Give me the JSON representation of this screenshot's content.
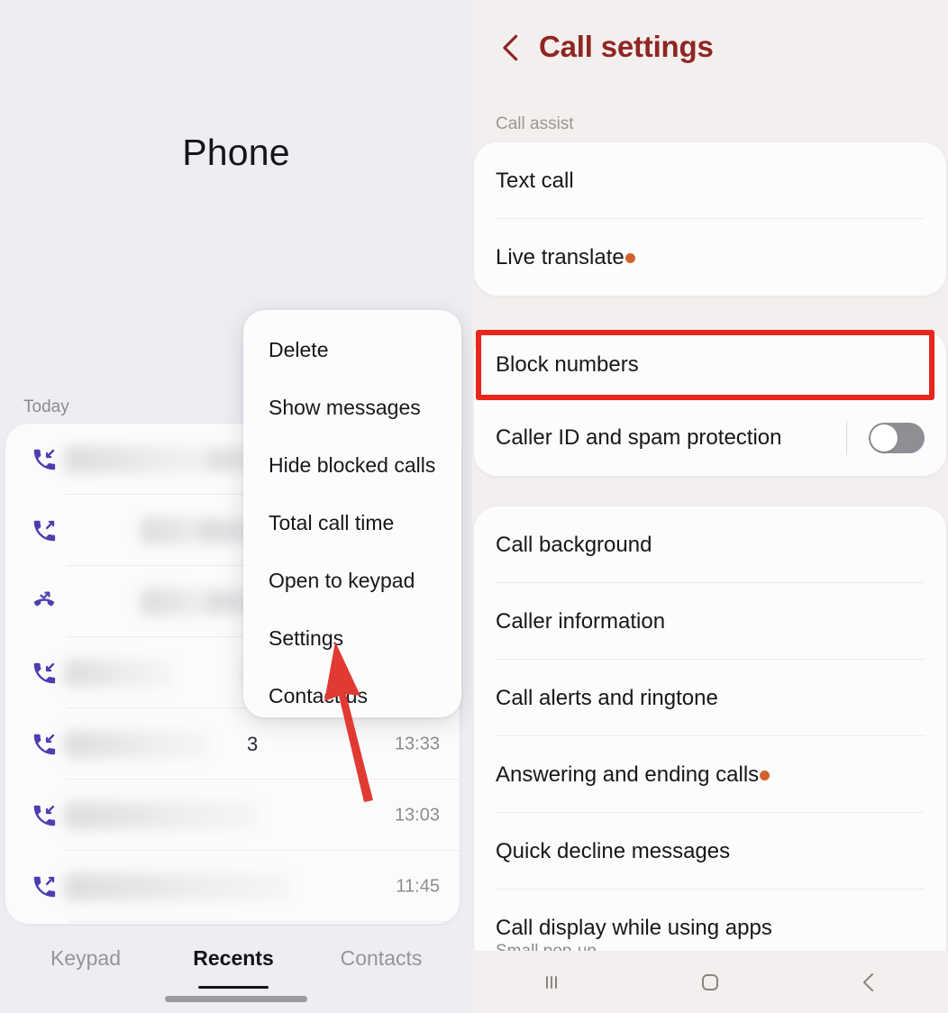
{
  "left": {
    "app_title": "Phone",
    "section_header": "Today",
    "calls": [
      {
        "icon": "incoming-call-icon",
        "time": "",
        "visible_text": ""
      },
      {
        "icon": "outgoing-call-icon",
        "time": "",
        "visible_text": ""
      },
      {
        "icon": "missed-call-icon",
        "time": "",
        "visible_text": ""
      },
      {
        "icon": "incoming-call-icon",
        "time": "",
        "visible_text": ""
      },
      {
        "icon": "incoming-call-icon",
        "time": "13:33",
        "visible_text": "3"
      },
      {
        "icon": "incoming-call-icon",
        "time": "13:03",
        "visible_text": ""
      },
      {
        "icon": "outgoing-call-icon",
        "time": "11:45",
        "visible_text": ""
      }
    ],
    "menu": {
      "items": [
        {
          "label": "Delete"
        },
        {
          "label": "Show messages"
        },
        {
          "label": "Hide blocked calls"
        },
        {
          "label": "Total call time"
        },
        {
          "label": "Open to keypad"
        },
        {
          "label": "Settings"
        },
        {
          "label": "Contact us"
        }
      ]
    },
    "tabs": [
      {
        "label": "Keypad",
        "active": false
      },
      {
        "label": "Recents",
        "active": true
      },
      {
        "label": "Contacts",
        "active": false
      }
    ]
  },
  "right": {
    "header": {
      "title": "Call settings",
      "back_icon": "chevron-left-icon"
    },
    "section_label": "Call assist",
    "group1": [
      {
        "label": "Text call",
        "badge": false
      },
      {
        "label": "Live translate",
        "badge": true
      }
    ],
    "group2": [
      {
        "label": "Block numbers",
        "badge": false,
        "toggle": null,
        "highlighted": true
      },
      {
        "label": "Caller ID and spam protection",
        "badge": false,
        "toggle": "off",
        "highlighted": false
      }
    ],
    "group3": [
      {
        "label": "Call background",
        "badge": false,
        "sub": ""
      },
      {
        "label": "Caller information",
        "badge": false,
        "sub": ""
      },
      {
        "label": "Call alerts and ringtone",
        "badge": false,
        "sub": ""
      },
      {
        "label": "Answering and ending calls",
        "badge": true,
        "sub": ""
      },
      {
        "label": "Quick decline messages",
        "badge": false,
        "sub": ""
      },
      {
        "label": "Call display while using apps",
        "badge": false,
        "sub": "Small pop-up"
      }
    ],
    "navbar": [
      {
        "name": "recents-nav-icon"
      },
      {
        "name": "home-nav-icon"
      },
      {
        "name": "back-nav-icon"
      }
    ]
  },
  "annotations": {
    "highlight_color": "#e8261b",
    "arrow_color": "#e03a33",
    "badge_color": "#d2622c",
    "accent_color": "#8f2622",
    "call_icon_color": "#4b3fb0",
    "arrow_target": "Settings",
    "highlight_target": "Block numbers"
  }
}
